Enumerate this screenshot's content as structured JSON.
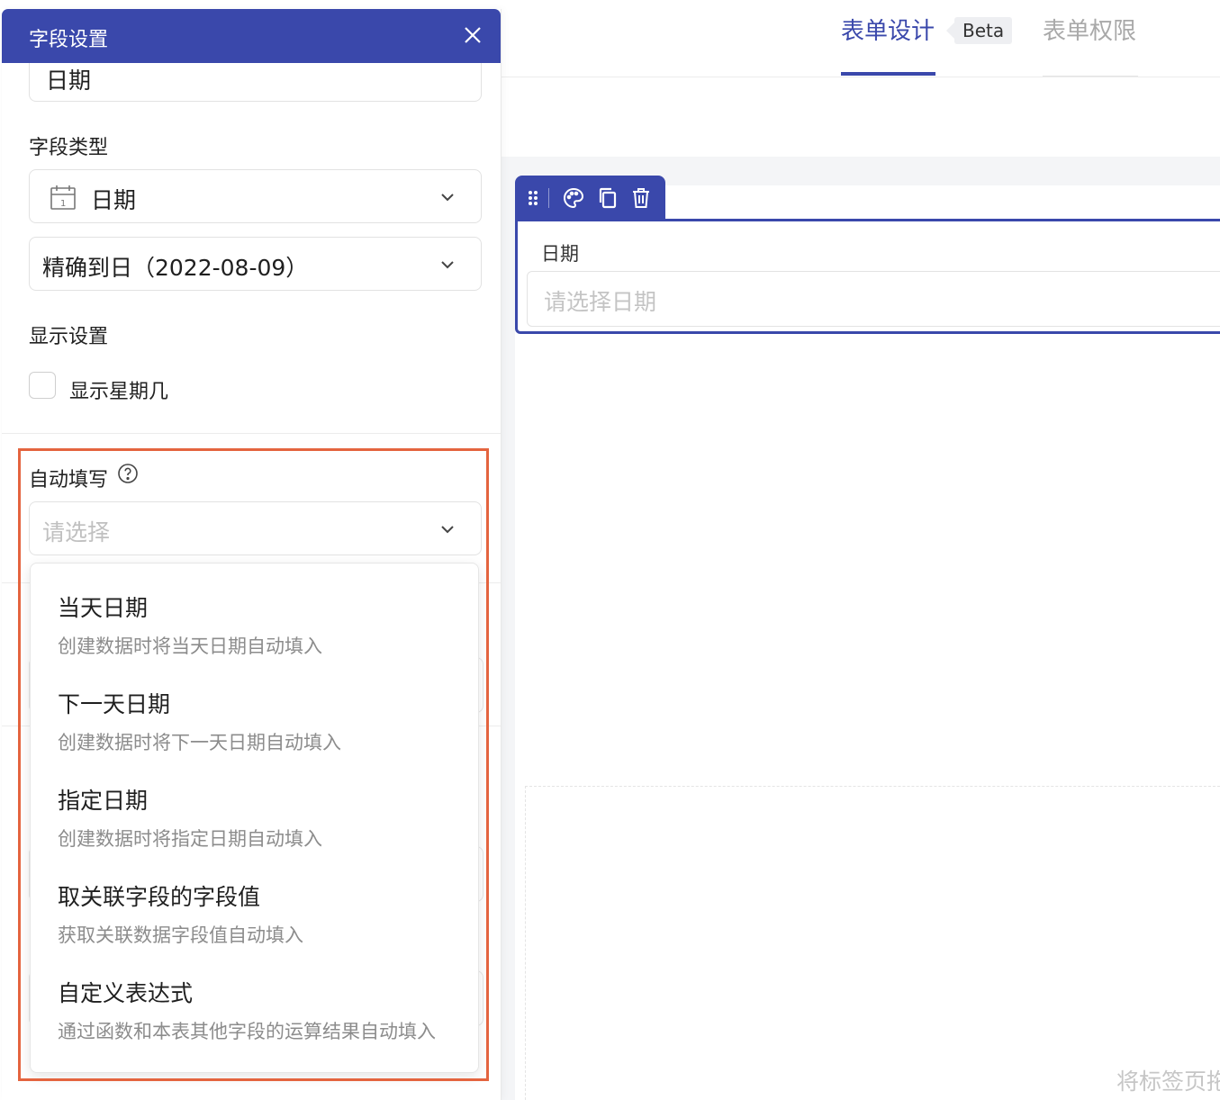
{
  "colors": {
    "primary": "#3a48ab",
    "highlight": "#e4643f"
  },
  "header": {
    "tabs": [
      {
        "label": "表单设计",
        "active": true
      },
      {
        "label": "表单权限",
        "active": false
      }
    ],
    "beta_badge": "Beta"
  },
  "field_toolbar": {
    "icons": [
      "drag-handle-icon",
      "palette-icon",
      "copy-icon",
      "delete-icon"
    ]
  },
  "canvas": {
    "field": {
      "label": "日期",
      "placeholder": "请选择日期"
    },
    "hint": "将标签页拖"
  },
  "panel": {
    "title": "字段设置",
    "field_name": "日期",
    "type_label": "字段类型",
    "type_value": "日期",
    "precision_value": "精确到日（2022-08-09）",
    "display_label": "显示设置",
    "show_weekday_label": "显示星期几",
    "show_weekday_checked": false,
    "autofill_label": "自动填写",
    "autofill_placeholder": "请选择",
    "autofill_options": [
      {
        "title": "当天日期",
        "desc": "创建数据时将当天日期自动填入"
      },
      {
        "title": "下一天日期",
        "desc": "创建数据时将下一天日期自动填入"
      },
      {
        "title": "指定日期",
        "desc": "创建数据时将指定日期自动填入"
      },
      {
        "title": "取关联字段的字段值",
        "desc": "获取关联数据字段值自动填入"
      },
      {
        "title": "自定义表达式",
        "desc": "通过函数和本表其他字段的运算结果自动填入"
      }
    ]
  }
}
